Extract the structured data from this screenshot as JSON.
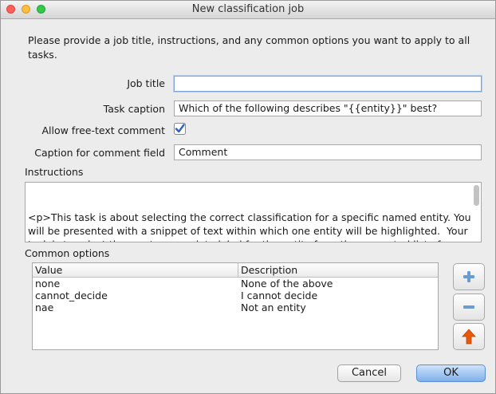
{
  "window": {
    "title": "New classification job"
  },
  "intro": "Please provide a job title, instructions, and any common options you want to apply to all tasks.",
  "form": {
    "job_title_label": "Job title",
    "job_title_value": "",
    "task_caption_label": "Task caption",
    "task_caption_value": "Which of the following describes \"{{entity}}\" best?",
    "allow_comment_label": "Allow free-text comment",
    "allow_comment_checked": true,
    "comment_caption_label": "Caption for comment field",
    "comment_caption_value": "Comment",
    "instructions_label": "Instructions",
    "instructions_value": "<p>This task is about selecting the correct classification for a specific named entity. You will be presented with a snippet of text within which one entity will be highlighted.  Your task is to select the most appropriate label for the entity from the presented list of options.</p>\n<ul>"
  },
  "options": {
    "label": "Common options",
    "columns": [
      "Value",
      "Description"
    ],
    "rows": [
      [
        "none",
        "None of the above"
      ],
      [
        "cannot_decide",
        "I cannot decide"
      ],
      [
        "nae",
        "Not an entity"
      ]
    ]
  },
  "side_buttons": [
    {
      "icon": "plus-icon",
      "color": "#6a9bd1"
    },
    {
      "icon": "minus-icon",
      "color": "#6a9bd1"
    },
    {
      "icon": "arrow-up-icon",
      "color": "#e8590c"
    }
  ],
  "buttons": {
    "cancel": "Cancel",
    "ok": "OK"
  }
}
